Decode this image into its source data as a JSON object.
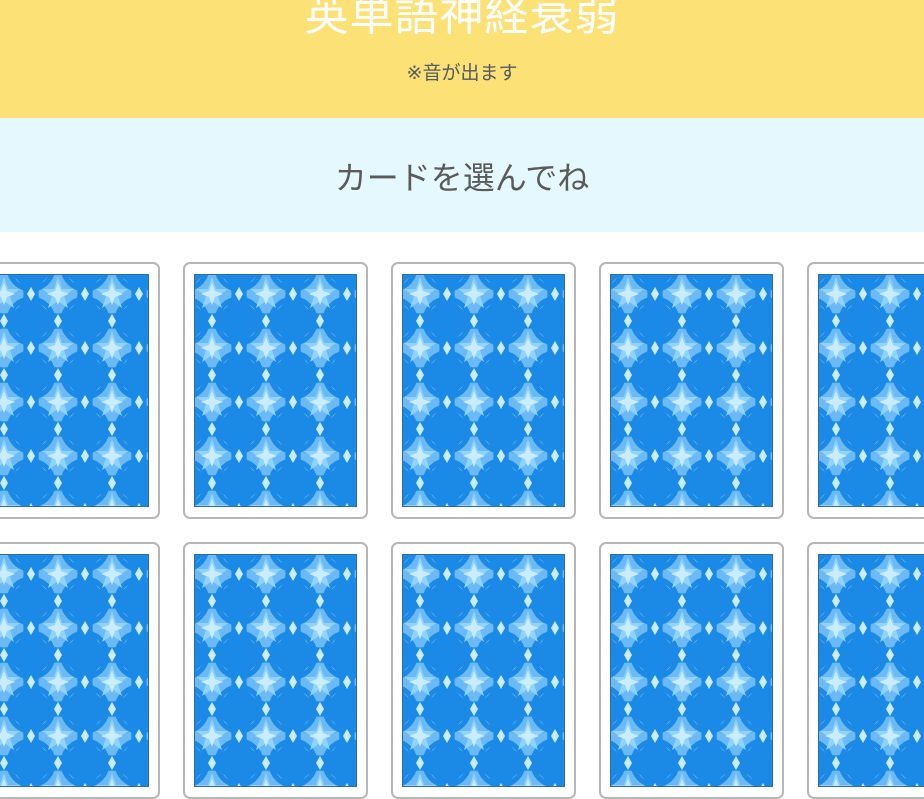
{
  "header": {
    "title": "英単語神経衰弱",
    "subtitle": "※音が出ます"
  },
  "prompt": {
    "text": "カードを選んでね"
  },
  "colors": {
    "header_bg": "#fbe176",
    "prompt_bg": "#e4f8fd",
    "card_pattern_dark": "#1a8ae6",
    "card_pattern_light": "#8fd3ff"
  },
  "cards": [
    {
      "state": "face-down"
    },
    {
      "state": "face-down"
    },
    {
      "state": "face-down"
    },
    {
      "state": "face-down"
    },
    {
      "state": "face-down"
    },
    {
      "state": "face-down"
    },
    {
      "state": "face-down"
    },
    {
      "state": "face-down"
    },
    {
      "state": "face-down"
    },
    {
      "state": "face-down"
    }
  ]
}
